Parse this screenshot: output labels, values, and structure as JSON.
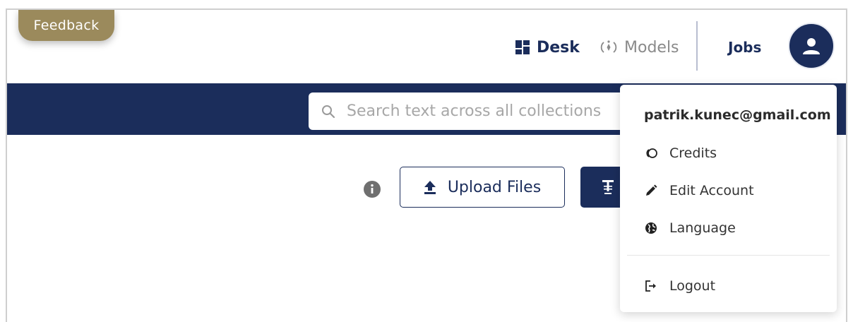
{
  "feedback": {
    "label": "Feedback"
  },
  "nav": {
    "desk_label": "Desk",
    "models_label": "Models",
    "jobs_label": "Jobs"
  },
  "search": {
    "placeholder": "Search text across all collections",
    "value": ""
  },
  "actions": {
    "upload_label": "Upload Files"
  },
  "account_menu": {
    "email": "patrik.kunec@gmail.com",
    "items": [
      {
        "label": "Credits",
        "icon": "credits-icon"
      },
      {
        "label": "Edit Account",
        "icon": "pencil-icon"
      },
      {
        "label": "Language",
        "icon": "globe-icon"
      },
      {
        "label": "Logout",
        "icon": "logout-icon"
      }
    ]
  },
  "colors": {
    "brand_navy": "#1b2d5b",
    "feedback_gold": "#9b8a5c",
    "muted_gray": "#8a8a8a"
  }
}
